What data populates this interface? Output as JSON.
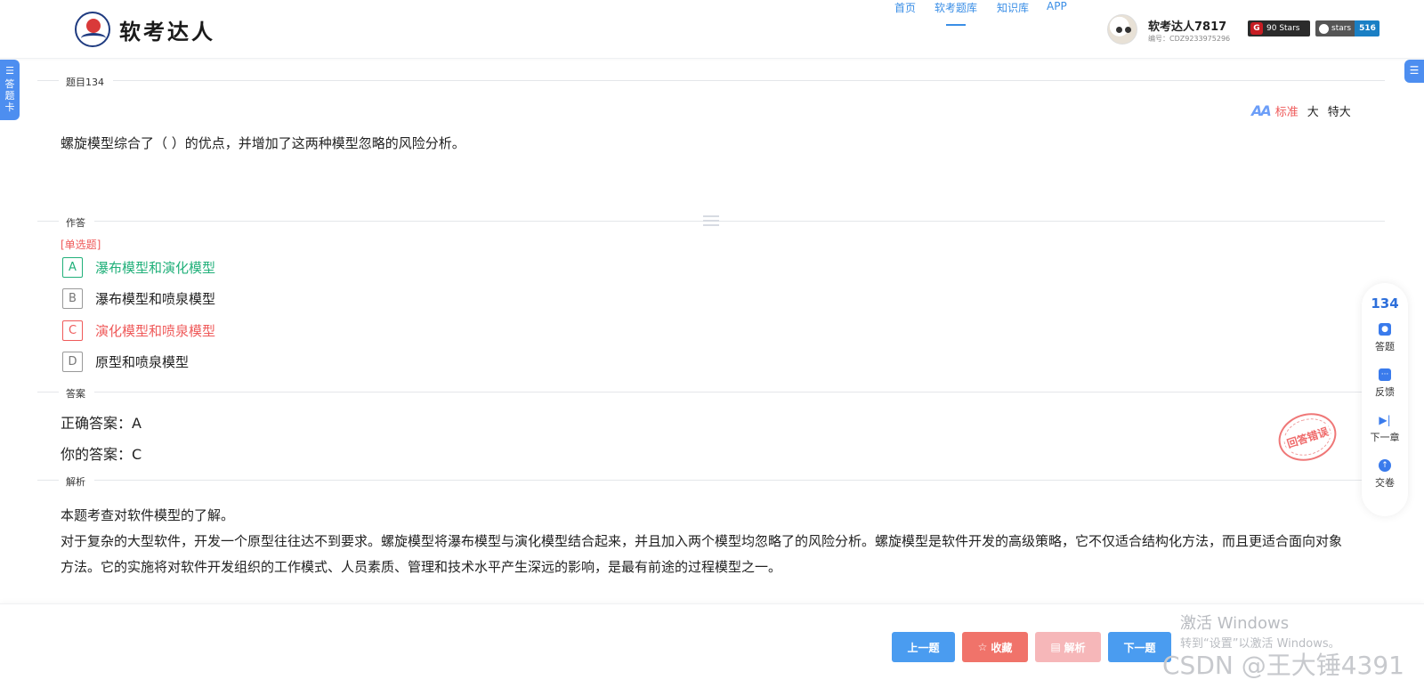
{
  "brand": {
    "name": "软考达人"
  },
  "nav": [
    {
      "label": "首页",
      "active": false
    },
    {
      "label": "软考题库",
      "active": true
    },
    {
      "label": "知识库",
      "active": false
    },
    {
      "label": "APP",
      "active": false
    }
  ],
  "user": {
    "name": "软考达人7817",
    "id": "编号：CDZ9233975296"
  },
  "badges": {
    "gitee": "90 Stars",
    "github_label": "stars",
    "github_count": "516"
  },
  "side": {
    "answer_card_icon": "☰",
    "answer_card_label": "答题卡",
    "right_icon": "☰"
  },
  "sections": {
    "question": "题目134",
    "response": "作答",
    "answer": "答案",
    "analysis": "解析"
  },
  "font_switch": {
    "icon_text": "AA",
    "options": [
      "标准",
      "大",
      "特大"
    ],
    "active": 0
  },
  "question": {
    "text": "螺旋模型综合了（ ）的优点，并增加了这两种模型忽略的风险分析。",
    "type": "[单选题]"
  },
  "options": [
    {
      "letter": "A",
      "text": "瀑布模型和演化模型",
      "state": "correct"
    },
    {
      "letter": "B",
      "text": "瀑布模型和喷泉模型",
      "state": "normal"
    },
    {
      "letter": "C",
      "text": "演化模型和喷泉模型",
      "state": "wrong"
    },
    {
      "letter": "D",
      "text": "原型和喷泉模型",
      "state": "normal"
    }
  ],
  "answer": {
    "correct": "正确答案：A",
    "yours": "你的答案：C",
    "stamp": "回答错误"
  },
  "analysis": {
    "p1": "本题考查对软件模型的了解。",
    "p2": "对于复杂的大型软件，开发一个原型往往达不到要求。螺旋模型将瀑布模型与演化模型结合起来，并且加入两个模型均忽略了的风险分析。螺旋模型是软件开发的高级策略，它不仅适合结构化方法，而且更适合面向对象方法。它的实施将对软件开发组织的工作模式、人员素质、管理和技术水平产生深远的影响，是最有前途的过程模型之一。"
  },
  "float_panel": {
    "number": "134",
    "items": [
      {
        "label": "答题"
      },
      {
        "label": "反馈"
      },
      {
        "label": "下一章"
      },
      {
        "label": "交卷"
      }
    ]
  },
  "buttons": {
    "prev": "上一题",
    "fav": "收藏",
    "analysis": "解析",
    "next": "下一题"
  },
  "watermarks": {
    "activate_title": "激活 Windows",
    "activate_sub": "转到“设置”以激活 Windows。",
    "csdn": "CSDN @王大锤4391"
  },
  "colors": {
    "accent": "#3a8ee6",
    "correct": "#21b07a",
    "wrong": "#ef5a5a",
    "panel_blue": "#4d8ef0"
  }
}
